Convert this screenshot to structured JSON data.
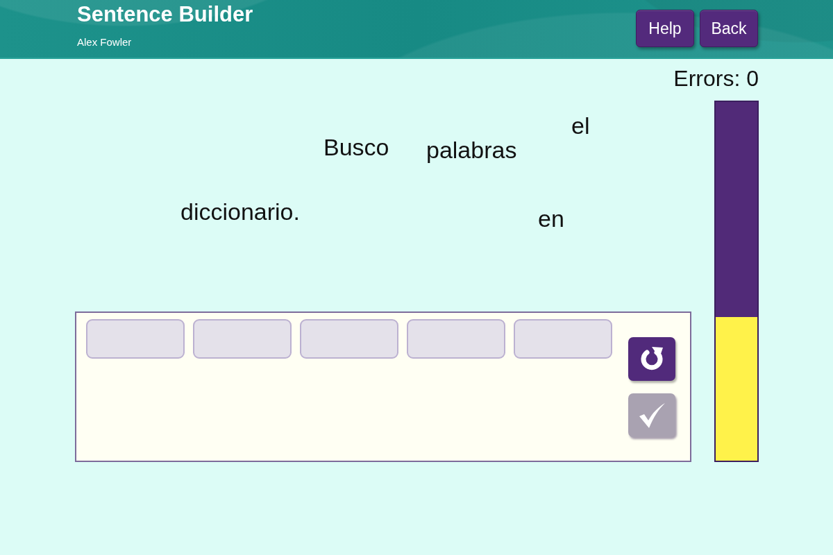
{
  "header": {
    "title": "Sentence Builder",
    "user": "Alex Fowler",
    "buttons": [
      "Help",
      "Back"
    ]
  },
  "errors": "Errors: 0",
  "words": [
    {
      "text": "Busco"
    },
    {
      "text": "palabras"
    },
    {
      "text": "el"
    },
    {
      "text": "diccionario."
    },
    {
      "text": "en"
    }
  ],
  "slots": [
    {
      "filled": false
    },
    {
      "filled": false
    },
    {
      "filled": false
    },
    {
      "filled": false
    },
    {
      "filled": false
    }
  ],
  "actions": [
    {
      "kind": "reset",
      "disabled": false
    },
    {
      "kind": "check",
      "disabled": true
    }
  ],
  "progress": {
    "level": 0.4
  }
}
